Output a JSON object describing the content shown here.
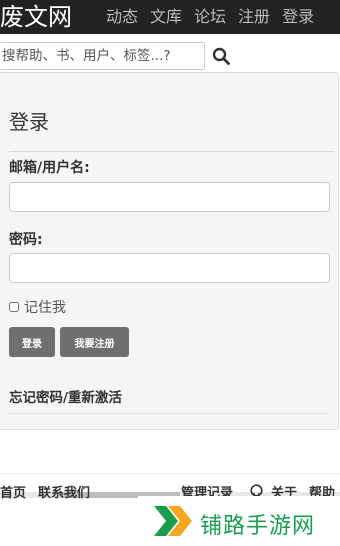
{
  "header": {
    "logo": "废文网",
    "nav": [
      "动态",
      "文库",
      "论坛",
      "注册",
      "登录"
    ]
  },
  "search": {
    "placeholder": "搜帮助、书、用户、标签...?",
    "icon": "search-icon"
  },
  "login": {
    "title": "登录",
    "username_label": "邮箱/用户名:",
    "username_value": "",
    "password_label": "密码:",
    "password_value": "",
    "remember_label": "记住我",
    "login_button": "登录",
    "register_button": "我要注册",
    "forgot_link": "忘记密码/重新激活"
  },
  "footer": {
    "home": "首页",
    "contact": "联系我们",
    "admin_log": "管理记录",
    "github_icon": "github-icon",
    "about": "关于",
    "help": "帮助"
  },
  "watermark": {
    "text": "铺路手游网",
    "colors": {
      "primary": "#1a9e4e",
      "secondary": "#f5a623"
    }
  },
  "colors": {
    "topbar_bg": "#222222",
    "panel_bg": "#f5f5f5",
    "button_bg": "#6f6f6f"
  }
}
